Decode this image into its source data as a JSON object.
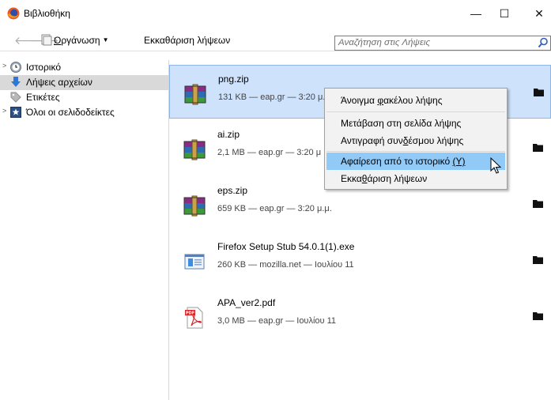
{
  "window": {
    "title": "Βιβλιοθήκη",
    "controls": {
      "minimize": "—",
      "maximize": "☐",
      "close": "✕"
    }
  },
  "toolbar": {
    "organize": {
      "prefix": "",
      "accel": "Ο",
      "rest": "ργάνωση"
    },
    "clear_downloads": "Εκκαθάριση λήψεων",
    "search_placeholder": "Αναζήτηση στις Λήψεις"
  },
  "sidebar": {
    "items": [
      {
        "label": "Ιστορικό",
        "icon": "history-clock-icon",
        "expandable": true
      },
      {
        "label": "Λήψεις αρχείων",
        "icon": "downloads-arrow-icon",
        "expandable": false,
        "selected": true
      },
      {
        "label": "Ετικέτες",
        "icon": "tag-icon",
        "expandable": false
      },
      {
        "label": "Όλοι οι σελιδοδείκτες",
        "icon": "bookmarks-star-icon",
        "expandable": true
      }
    ]
  },
  "downloads": [
    {
      "name": "png.zip",
      "status": "131 KB — eap.gr — 3:20 μ.",
      "icon": "winrar-archive-icon",
      "selected": true
    },
    {
      "name": "ai.zip",
      "status": "2,1 MB — eap.gr — 3:20 μ",
      "icon": "winrar-archive-icon"
    },
    {
      "name": "eps.zip",
      "status": "659 KB — eap.gr — 3:20 μ.μ.",
      "icon": "winrar-archive-icon"
    },
    {
      "name": "Firefox Setup Stub 54.0.1(1).exe",
      "status": "260 KB — mozilla.net — Ιουλίου 11",
      "icon": "installer-exe-icon"
    },
    {
      "name": "APA_ver2.pdf",
      "status": "3,0 MB — eap.gr — Ιουλίου 11",
      "icon": "pdf-file-icon"
    }
  ],
  "context_menu": {
    "items": [
      {
        "before": "Άνοιγμα ",
        "accel": "φ",
        "after": "ακέλου λήψης"
      },
      {
        "before": "Μετάβαση στη σελίδα λήψης",
        "accel": "",
        "after": ""
      },
      {
        "before": "Αντιγραφή συν",
        "accel": "δ",
        "after": "έσμου λήψης"
      },
      {
        "before": "Αφαίρεση από το ιστορικό ",
        "accel": "(Y)",
        "after": "",
        "hover": true
      },
      {
        "before": "Εκκα",
        "accel": "θ",
        "after": "άριση λήψεων"
      }
    ]
  },
  "colors": {
    "selected_row_bg": "#cfe2fb",
    "menu_hover_bg": "#91c9f7",
    "sidebar_selected_bg": "#d9d9d9"
  }
}
